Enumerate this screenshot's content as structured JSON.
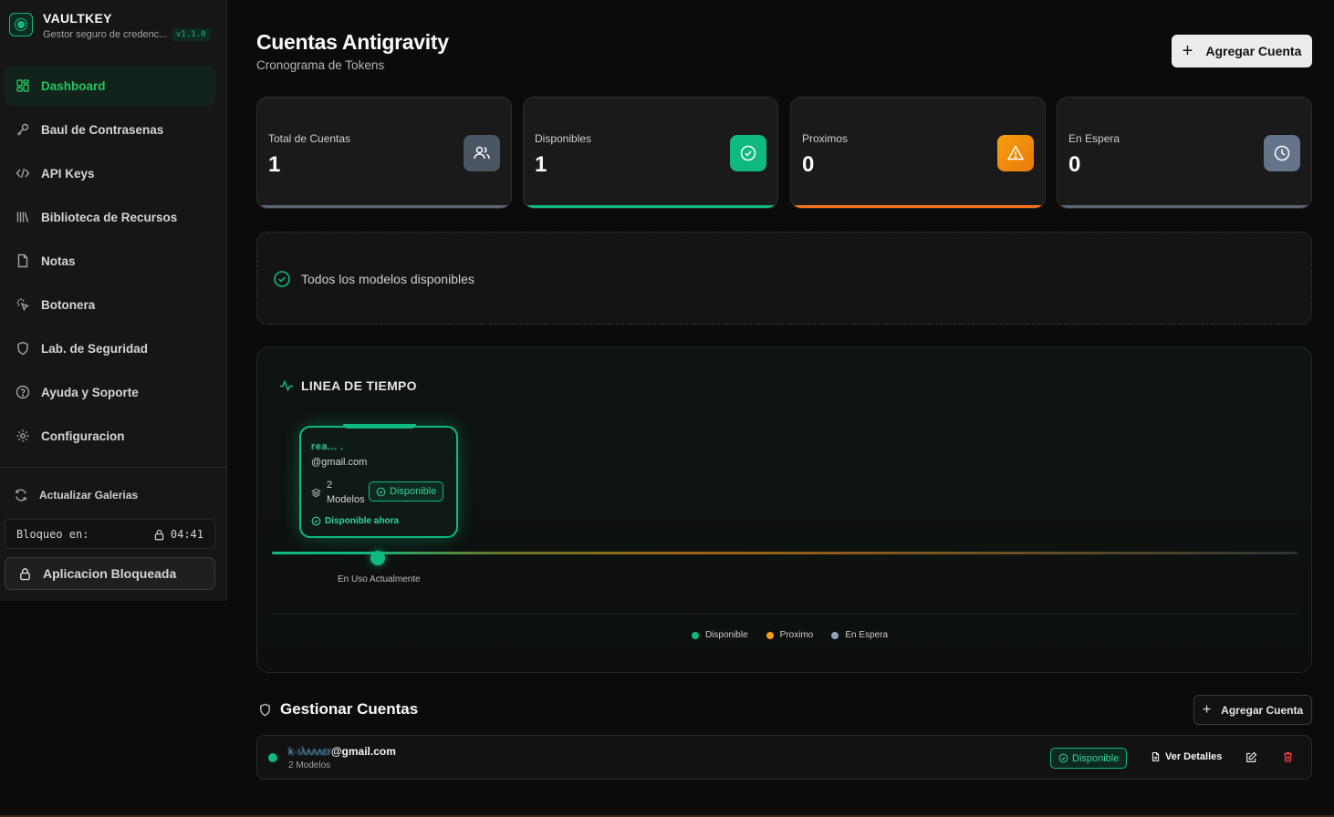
{
  "sidebar": {
    "brand_title": "VAULTKEY",
    "brand_subtitle": "Gestor seguro de credenc...",
    "version": "v1.1.0",
    "items": [
      {
        "label": "Dashboard",
        "icon": "dashboard-icon",
        "active": true
      },
      {
        "label": "Baul de Contrasenas",
        "icon": "key-icon"
      },
      {
        "label": "API Keys",
        "icon": "code-icon"
      },
      {
        "label": "Biblioteca de Recursos",
        "icon": "library-icon"
      },
      {
        "label": "Notas",
        "icon": "note-icon"
      },
      {
        "label": "Botonera",
        "icon": "pointer-click-icon"
      },
      {
        "label": "Lab. de Seguridad",
        "icon": "shield-icon"
      },
      {
        "label": "Ayuda y Soporte",
        "icon": "help-circle-icon"
      },
      {
        "label": "Configuracion",
        "icon": "gear-icon"
      }
    ],
    "refresh_label": "Actualizar Galerias",
    "lock_label": "Bloqueo en:",
    "lock_timer": "04:41",
    "locked_button": "Aplicacion Bloqueada"
  },
  "header": {
    "title": "Cuentas Antigravity",
    "subtitle": "Cronograma de Tokens",
    "add_button": "Agregar Cuenta"
  },
  "stats": [
    {
      "label": "Total de Cuentas",
      "value": "1",
      "icon": "users-icon",
      "color": "#4b5563",
      "bar": "#6b7280"
    },
    {
      "label": "Disponibles",
      "value": "1",
      "icon": "check-circle-icon",
      "color": "#10b981",
      "bar": "#10b981"
    },
    {
      "label": "Proximos",
      "value": "0",
      "icon": "warning-icon",
      "color": "#f59e0b",
      "bar": "#f97316"
    },
    {
      "label": "En Espera",
      "value": "0",
      "icon": "clock-icon",
      "color": "#64748b",
      "bar": "#6b7280"
    }
  ],
  "banner": {
    "text": "Todos los modelos disponibles"
  },
  "timeline": {
    "title": "LINEA DE TIEMPO",
    "card": {
      "name": "rea... .",
      "email": "@gmail.com",
      "models_count": "2",
      "models_label": "Modelos",
      "status": "Disponible",
      "availability": "Disponible ahora"
    },
    "marker_label": "En Uso Actualmente",
    "legend": [
      {
        "label": "Disponible",
        "color": "#10b981"
      },
      {
        "label": "Proximo",
        "color": "#f59e0b"
      },
      {
        "label": "En Espera",
        "color": "#94a3b8"
      }
    ]
  },
  "manage": {
    "title": "Gestionar Cuentas",
    "add_button": "Agregar Cuenta",
    "rows": [
      {
        "email_masked": "k·ıλʌʌʌɛr",
        "email_domain": "@gmail.com",
        "models": "2 Modelos",
        "status": "Disponible",
        "details": "Ver Detalles"
      }
    ]
  }
}
